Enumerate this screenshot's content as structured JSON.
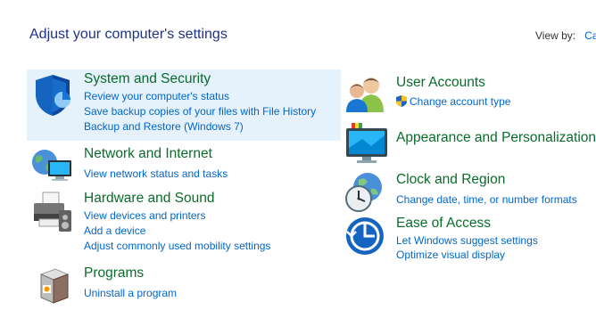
{
  "header": {
    "title": "Adjust your computer's settings",
    "view_by_label": "View by:",
    "view_by_value": "Ca"
  },
  "categories": [
    {
      "title": "System and Security",
      "icon": "shield-icon",
      "links": [
        "Review your computer's status",
        "Save backup copies of your files with File History",
        "Backup and Restore (Windows 7)"
      ]
    },
    {
      "title": "Network and Internet",
      "icon": "globe-network-icon",
      "links": [
        "View network status and tasks"
      ]
    },
    {
      "title": "Hardware and Sound",
      "icon": "printer-icon",
      "links": [
        "View devices and printers",
        "Add a device",
        "Adjust commonly used mobility settings"
      ]
    },
    {
      "title": "Programs",
      "icon": "programs-box-icon",
      "links": [
        "Uninstall a program"
      ]
    },
    {
      "title": "User Accounts",
      "icon": "users-icon",
      "links": [
        "Change account type"
      ]
    },
    {
      "title": "Appearance and Personalization",
      "icon": "monitor-icon",
      "links": []
    },
    {
      "title": "Clock and Region",
      "icon": "clock-globe-icon",
      "links": [
        "Change date, time, or number formats"
      ]
    },
    {
      "title": "Ease of Access",
      "icon": "ease-of-access-icon",
      "links": [
        "Let Windows suggest settings",
        "Optimize visual display"
      ]
    }
  ]
}
